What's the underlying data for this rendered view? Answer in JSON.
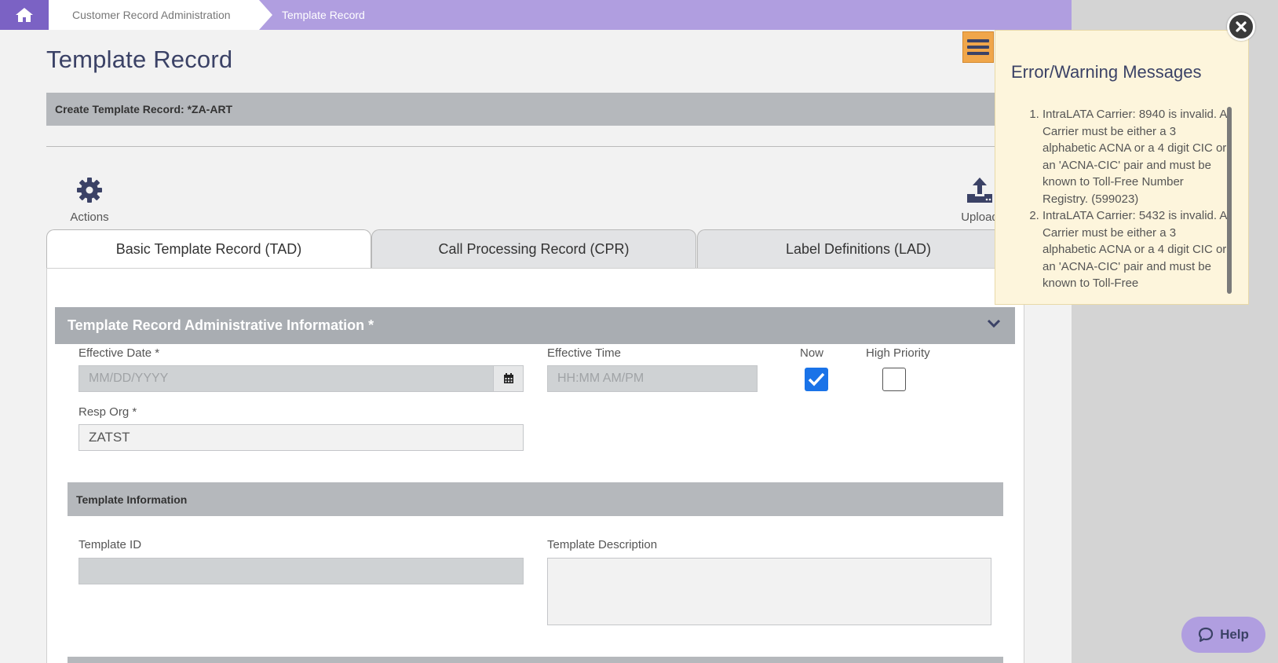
{
  "breadcrumb": {
    "home_icon": "home-icon",
    "items": [
      "Customer Record Administration",
      "Template Record"
    ]
  },
  "page": {
    "title": "Template Record",
    "create_label": "Create Template Record: *ZA-ART"
  },
  "toolbar": {
    "actions_label": "Actions",
    "actions_icon": "gear-icon",
    "upload_label": "Upload",
    "upload_icon": "upload-icon",
    "menu_icon": "hamburger-icon"
  },
  "tabs": [
    {
      "label": "Basic Template Record (TAD)",
      "active": true
    },
    {
      "label": "Call Processing Record (CPR)",
      "active": false
    },
    {
      "label": "Label Definitions (LAD)",
      "active": false
    }
  ],
  "admin_section": {
    "title": "Template Record Administrative Information *",
    "effective_date": {
      "label": "Effective Date *",
      "placeholder": "MM/DD/YYYY",
      "value": ""
    },
    "effective_time": {
      "label": "Effective Time",
      "placeholder": "HH:MM AM/PM",
      "value": ""
    },
    "now": {
      "label": "Now",
      "checked": true
    },
    "high_priority": {
      "label": "High Priority",
      "checked": false
    },
    "resp_org": {
      "label": "Resp Org *",
      "value": "ZATST"
    }
  },
  "template_info": {
    "title": "Template Information",
    "template_id": {
      "label": "Template ID",
      "value": ""
    },
    "template_description": {
      "label": "Template Description",
      "value": ""
    }
  },
  "error_panel": {
    "title": "Error/Warning Messages",
    "messages": [
      "IntraLATA Carrier: 8940 is invalid. A Carrier must be either a 3 alphabetic ACNA or a 4 digit CIC or an 'ACNA-CIC' pair and must be known to Toll-Free Number Registry. (599023)",
      "IntraLATA Carrier: 5432 is invalid. A Carrier must be either a 3 alphabetic ACNA or a 4 digit CIC or an 'ACNA-CIC' pair and must be known to Toll-Free"
    ]
  },
  "help": {
    "label": "Help",
    "icon": "chat-bubble-icon"
  },
  "colors": {
    "breadcrumb_bg": "#b09ee0",
    "home_bg": "#7b62c4",
    "title": "#3b4266",
    "menu_button": "#f0a64a",
    "error_panel_bg": "#fdf5dc",
    "checkbox_on": "#1a73e8"
  }
}
